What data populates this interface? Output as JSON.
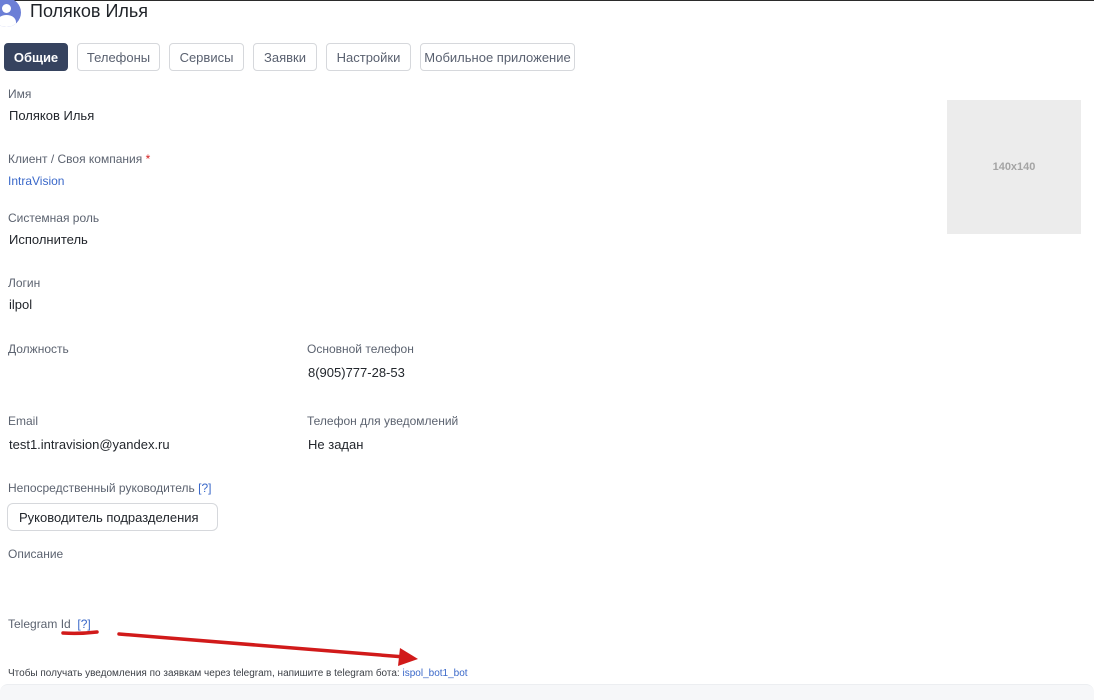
{
  "header": {
    "title": "Поляков Илья"
  },
  "tabs": [
    {
      "label": "Общие",
      "active": true
    },
    {
      "label": "Телефоны",
      "active": false
    },
    {
      "label": "Сервисы",
      "active": false
    },
    {
      "label": "Заявки",
      "active": false
    },
    {
      "label": "Настройки",
      "active": false
    },
    {
      "label": "Мобильное приложение",
      "active": false
    }
  ],
  "fields": {
    "name": {
      "label": "Имя",
      "value": "Поляков Илья"
    },
    "client": {
      "label": "Клиент / Своя компания",
      "required_mark": "*",
      "value": "IntraVision"
    },
    "role": {
      "label": "Системная роль",
      "value": "Исполнитель"
    },
    "login": {
      "label": "Логин",
      "value": "ilpol"
    },
    "position": {
      "label": "Должность",
      "value": ""
    },
    "main_phone": {
      "label": "Основной телефон",
      "value": "8(905)777-28-53"
    },
    "email": {
      "label": "Email",
      "value": "test1.intravision@yandex.ru"
    },
    "notify_phone": {
      "label": "Телефон для уведомлений",
      "value": "Не задан"
    },
    "manager": {
      "label": "Непосредственный руководитель",
      "help": "[?]",
      "value": "Руководитель подразделения"
    },
    "description": {
      "label": "Описание",
      "value": ""
    },
    "telegram": {
      "label": "Telegram Id",
      "help": "[?]"
    }
  },
  "photo": {
    "placeholder": "140x140"
  },
  "telegram_hint": {
    "text": "Чтобы получать уведомления по заявкам через telegram, напишите в telegram бота:",
    "bot": "ispol_bot1_bot"
  },
  "annotation": {
    "color": "#d11a1a"
  },
  "colors": {
    "accent": "#36435f",
    "link": "#3a68c9"
  }
}
